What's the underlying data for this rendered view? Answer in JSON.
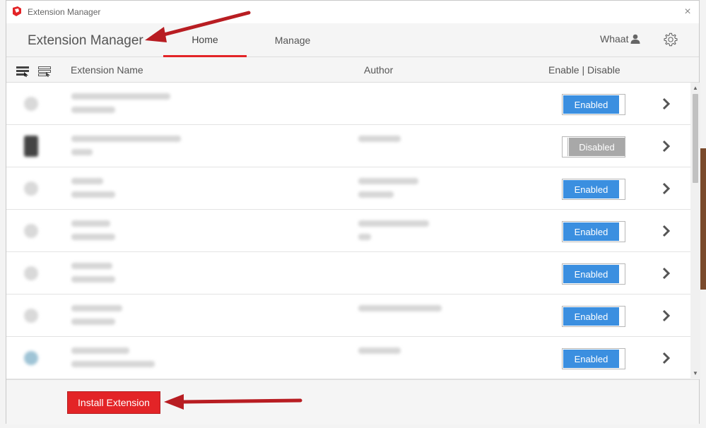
{
  "window": {
    "title": "Extension Manager",
    "close_label": "×"
  },
  "header": {
    "title": "Extension Manager",
    "tabs": [
      {
        "label": "Home",
        "active": true
      },
      {
        "label": "Manage",
        "active": false
      }
    ],
    "user_name": "Whaat",
    "icons": {
      "user": "user-icon",
      "settings": "gear-icon"
    }
  },
  "columns": {
    "name": "Extension Name",
    "author": "Author",
    "enable": "Enable | Disable",
    "view_icons": [
      "list-detail-view-icon",
      "list-compact-view-icon"
    ]
  },
  "extensions": [
    {
      "status_label": "Enabled",
      "enabled": true
    },
    {
      "status_label": "Disabled",
      "enabled": false
    },
    {
      "status_label": "Enabled",
      "enabled": true
    },
    {
      "status_label": "Enabled",
      "enabled": true
    },
    {
      "status_label": "Enabled",
      "enabled": true
    },
    {
      "status_label": "Enabled",
      "enabled": true
    },
    {
      "status_label": "Enabled",
      "enabled": true
    }
  ],
  "footer": {
    "install_label": "Install Extension"
  },
  "colors": {
    "accent": "#e32427",
    "enabled": "#3b8fe0",
    "disabled": "#a8a8a8",
    "annotation_arrow": "#b81d22"
  }
}
